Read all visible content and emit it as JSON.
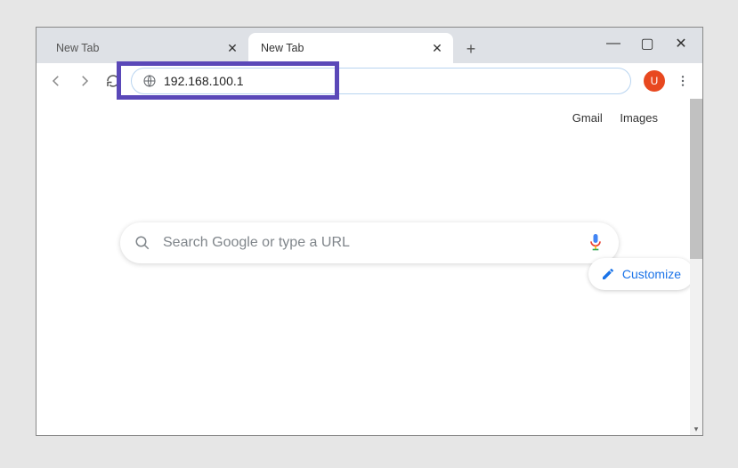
{
  "tabs": [
    {
      "label": "New Tab",
      "active": false
    },
    {
      "label": "New Tab",
      "active": true
    }
  ],
  "omnibox": {
    "value": "192.168.100.1"
  },
  "profile": {
    "letter": "U",
    "color": "#e8481f"
  },
  "top_links": {
    "gmail": "Gmail",
    "images": "Images"
  },
  "search": {
    "placeholder": "Search Google or type a URL"
  },
  "customize_label": "Customize"
}
